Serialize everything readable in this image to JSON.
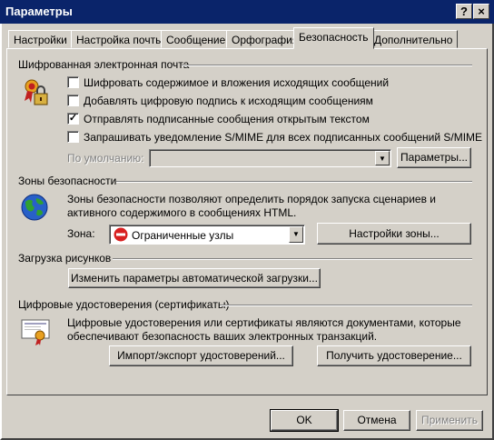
{
  "window": {
    "title": "Параметры",
    "help_btn": "?",
    "close_btn": "×"
  },
  "tabs": [
    {
      "label": "Настройки"
    },
    {
      "label": "Настройка почты"
    },
    {
      "label": "Сообщение"
    },
    {
      "label": "Орфография"
    },
    {
      "label": "Безопасность"
    },
    {
      "label": "Дополнительно"
    }
  ],
  "encrypted_mail": {
    "heading": "Шифрованная электронная почта",
    "options": [
      {
        "label": "Шифровать содержимое и вложения исходящих сообщений",
        "checked": false
      },
      {
        "label": "Добавлять цифровую подпись к исходящим сообщениям",
        "checked": false
      },
      {
        "label": "Отправлять подписанные сообщения открытым текстом",
        "checked": true
      },
      {
        "label": "Запрашивать уведомление S/MIME для всех подписанных сообщений S/MIME",
        "checked": false
      }
    ],
    "default_label": "По умолчанию:",
    "default_value": "",
    "settings_button": "Параметры..."
  },
  "security_zones": {
    "heading": "Зоны безопасности",
    "description": "Зоны безопасности позволяют определить порядок запуска сценариев и активного содержимого в сообщениях HTML.",
    "zone_label": "Зона:",
    "zone_value": "Ограниченные узлы",
    "zone_settings_button": "Настройки зоны..."
  },
  "downloads": {
    "heading": "Загрузка рисунков",
    "change_button": "Изменить параметры автоматической загрузки..."
  },
  "certificates": {
    "heading": "Цифровые удостоверения (сертификаты)",
    "description": "Цифровые удостоверения или сертификаты являются документами, которые обеспечивают безопасность ваших электронных транзакций.",
    "import_button": "Импорт/экспорт удостоверений...",
    "get_button": "Получить удостоверение..."
  },
  "footer": {
    "ok": "OK",
    "cancel": "Отмена",
    "apply": "Применить"
  },
  "icons": [
    "lock-certificate-icon",
    "globe-icon",
    "certificate-icon",
    "no-entry-icon",
    "check-icon",
    "chevron-down-icon"
  ]
}
